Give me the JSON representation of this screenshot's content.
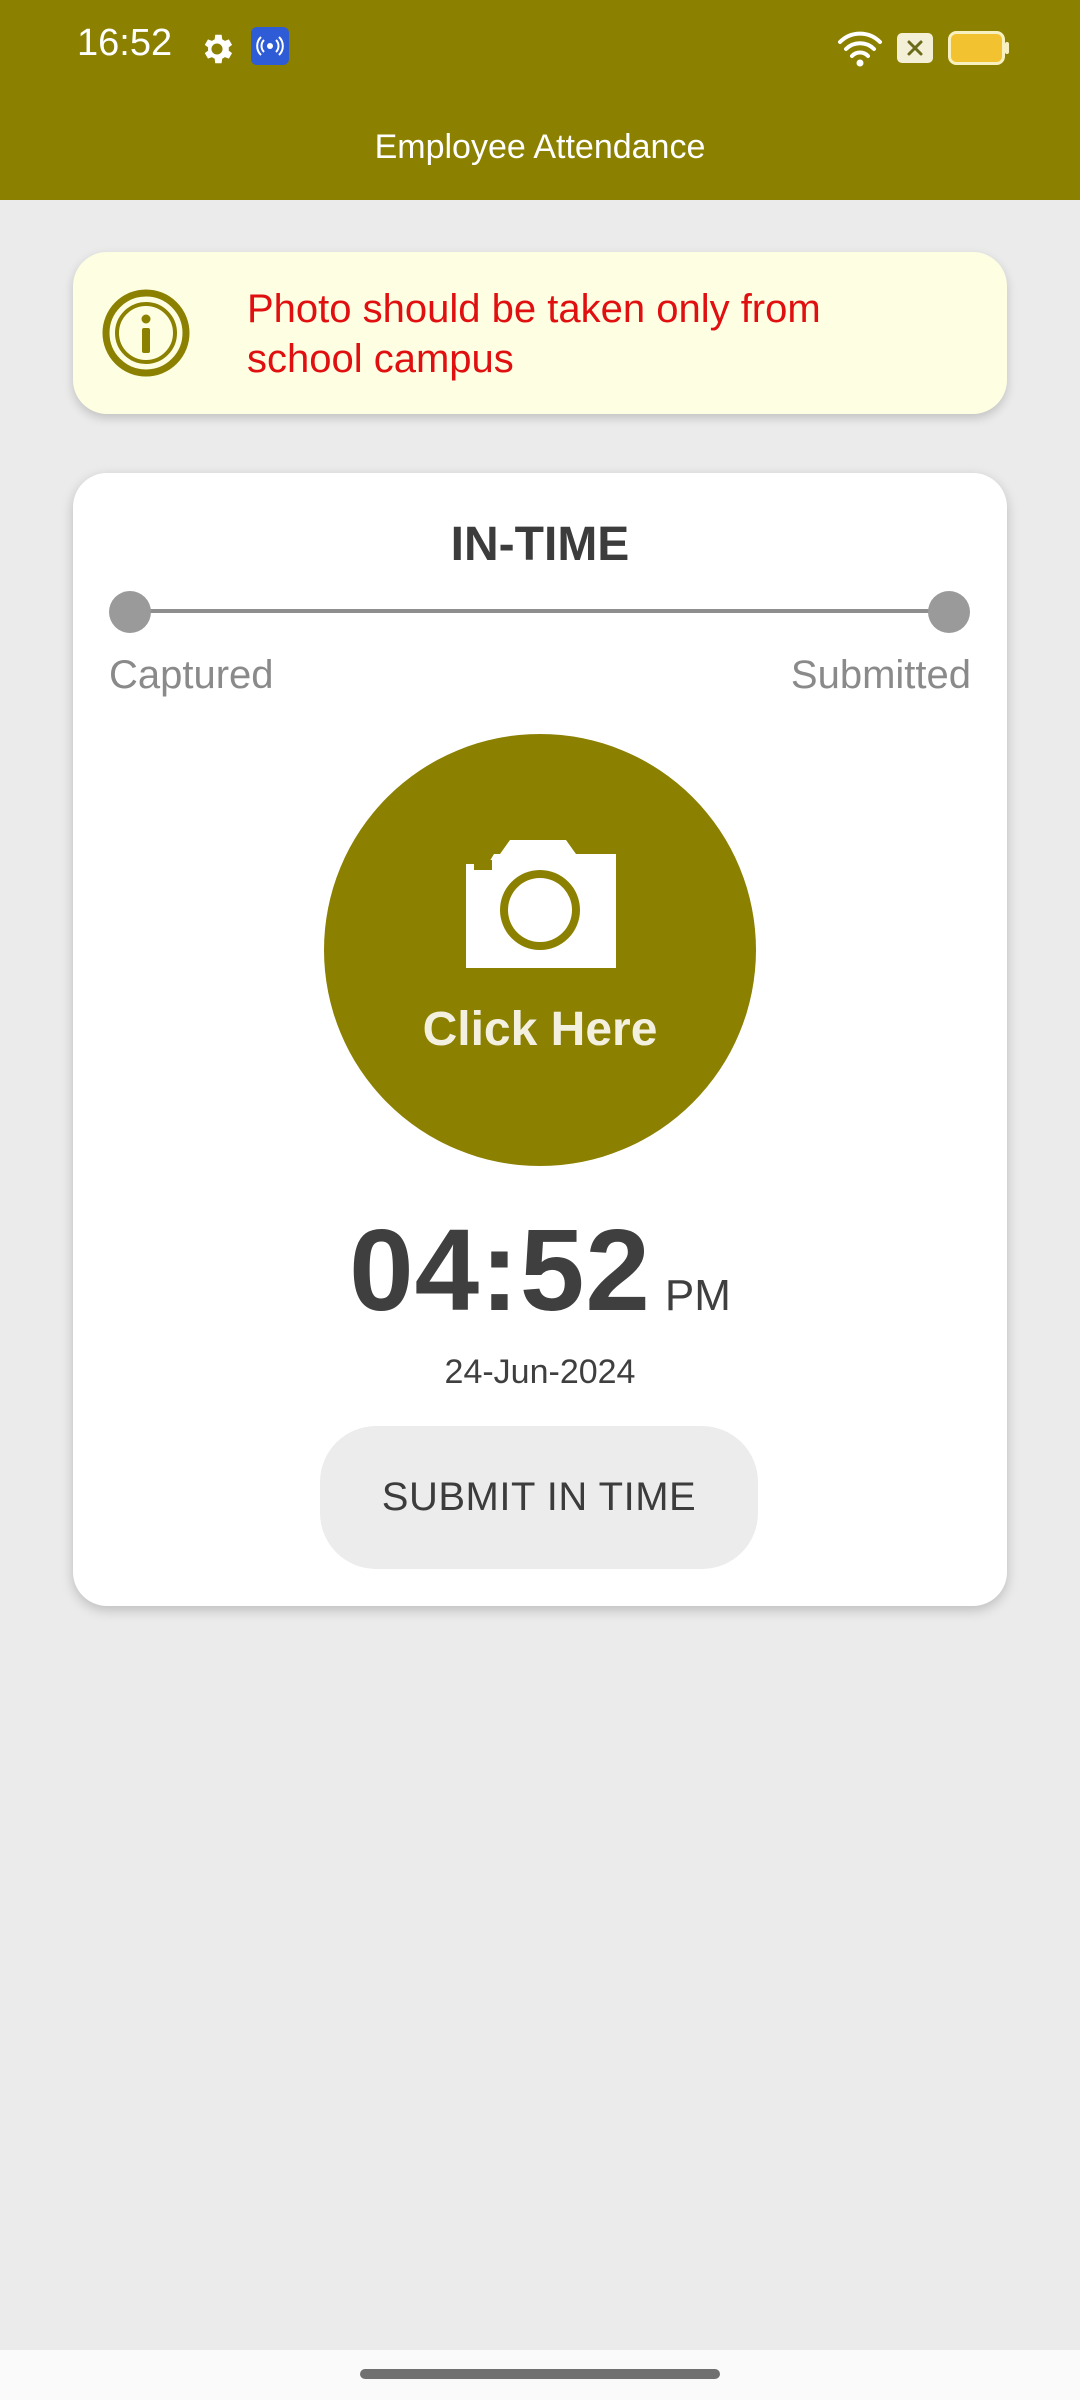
{
  "status_bar": {
    "time": "16:52",
    "icons": [
      "gear-icon",
      "broadcast-icon",
      "wifi-icon",
      "sim-icon",
      "battery-icon"
    ]
  },
  "header": {
    "title": "Employee Attendance"
  },
  "info_banner": {
    "icon": "info-icon",
    "message": "Photo should be taken only from school campus"
  },
  "attendance_card": {
    "title": "IN-TIME",
    "steps": [
      "Captured",
      "Submitted"
    ],
    "camera": {
      "icon": "camera-icon",
      "label": "Click Here"
    },
    "time": "04:52",
    "ampm": "PM",
    "date": "24-Jun-2024",
    "submit_label": "SUBMIT IN TIME"
  },
  "colors": {
    "primary": "#8b8000",
    "background": "#ebebeb",
    "banner_bg": "#fefee2",
    "warning_text": "#e01010",
    "button_bg": "#ececec"
  }
}
